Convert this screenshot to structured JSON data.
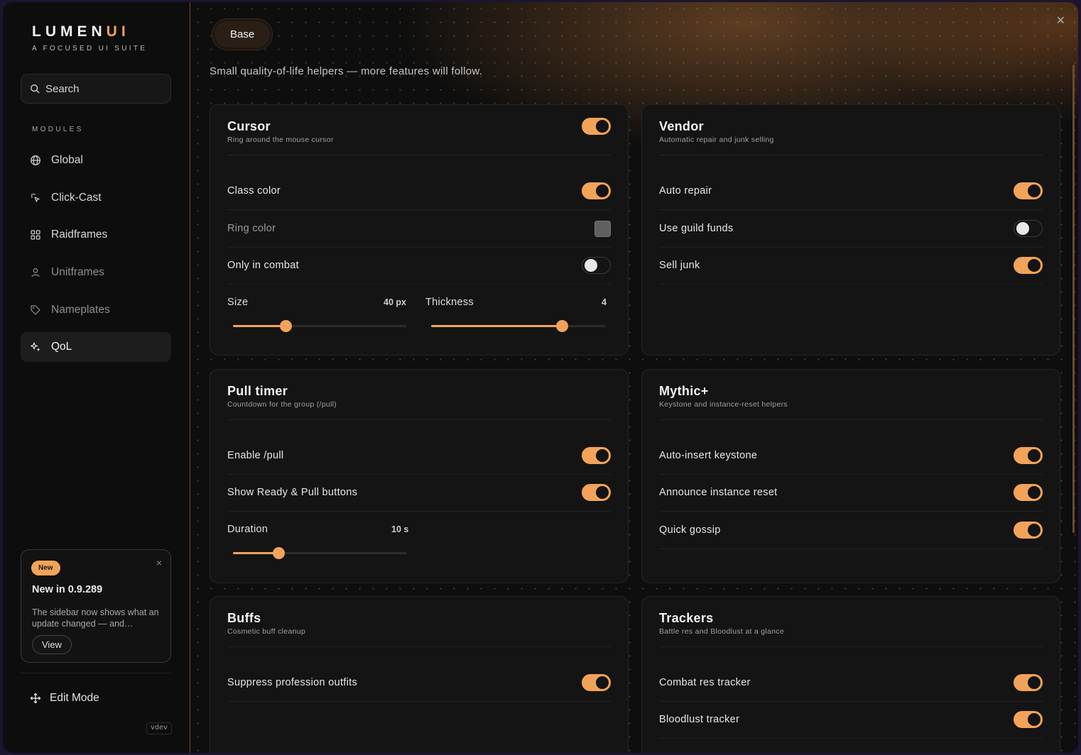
{
  "brand": {
    "name_main": "LUMEN",
    "name_accent": "UI",
    "tagline": "A FOCUSED UI SUITE"
  },
  "search": {
    "placeholder": "Search"
  },
  "sidebar": {
    "section_label": "MODULES",
    "items": [
      {
        "label": "Global",
        "icon": "globe-icon"
      },
      {
        "label": "Click-Cast",
        "icon": "click-icon"
      },
      {
        "label": "Raidframes",
        "icon": "grid-icon"
      },
      {
        "label": "Unitframes",
        "icon": "user-icon"
      },
      {
        "label": "Nameplates",
        "icon": "tag-icon"
      },
      {
        "label": "QoL",
        "icon": "sparkles-icon",
        "active": true
      }
    ],
    "news": {
      "badge": "New",
      "title": "New in 0.9.289",
      "body": "The sidebar now shows what an update changed — and…",
      "view_label": "View"
    },
    "edit_mode": "Edit Mode",
    "version": "vdev"
  },
  "main": {
    "tab": "Base",
    "subtitle": "Small quality-of-life helpers — more features will follow.",
    "cards": {
      "cursor": {
        "title": "Cursor",
        "desc": "Ring around the mouse cursor",
        "enabled": true,
        "rows": [
          {
            "label": "Class color",
            "type": "toggle",
            "on": true
          },
          {
            "label": "Ring color",
            "type": "swatch",
            "color": "#606060"
          },
          {
            "label": "Only in combat",
            "type": "toggle",
            "on": false
          }
        ],
        "size": {
          "label": "Size",
          "value": "40 px",
          "fraction": 0.3
        },
        "thickness": {
          "label": "Thickness",
          "value": "4",
          "fraction": 0.75
        }
      },
      "vendor": {
        "title": "Vendor",
        "desc": "Automatic repair and junk selling",
        "rows": [
          {
            "label": "Auto repair",
            "on": true
          },
          {
            "label": "Use guild funds",
            "on": false
          },
          {
            "label": "Sell junk",
            "on": true
          }
        ]
      },
      "pull": {
        "title": "Pull timer",
        "desc": "Countdown for the group (/pull)",
        "rows": [
          {
            "label": "Enable /pull",
            "on": true
          },
          {
            "label": "Show Ready & Pull buttons",
            "on": true
          }
        ],
        "duration": {
          "label": "Duration",
          "value": "10 s",
          "fraction": 0.26
        }
      },
      "mythic": {
        "title": "Mythic+",
        "desc": "Keystone and instance-reset helpers",
        "rows": [
          {
            "label": "Auto-insert keystone",
            "on": true
          },
          {
            "label": "Announce instance reset",
            "on": true
          },
          {
            "label": "Quick gossip",
            "on": true
          }
        ]
      },
      "buffs": {
        "title": "Buffs",
        "desc": "Cosmetic buff cleanup",
        "rows": [
          {
            "label": "Suppress profession outfits",
            "on": true
          }
        ]
      },
      "trackers": {
        "title": "Trackers",
        "desc": "Battle res and Bloodlust at a glance",
        "rows": [
          {
            "label": "Combat res tracker",
            "on": true
          },
          {
            "label": "Bloodlust tracker",
            "on": true
          }
        ]
      }
    }
  },
  "colors": {
    "accent": "#f2a35a",
    "background": "#0f0f0f",
    "card": "#141414"
  }
}
